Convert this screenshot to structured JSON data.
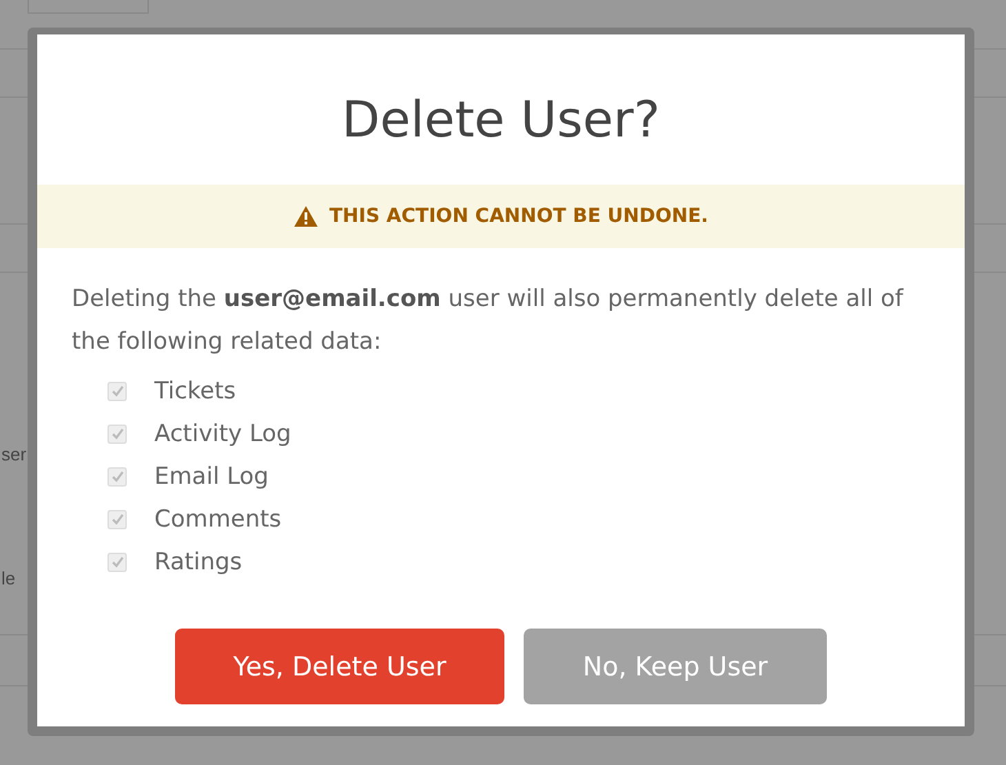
{
  "background": {
    "fragments": [
      "ser",
      "le"
    ]
  },
  "dialog": {
    "title": "Delete User?",
    "warning": "THIS ACTION CANNOT BE UNDONE.",
    "message": "Deleting the **user@email.com** user will also permanently delete all of the following related data:",
    "items": [
      {
        "label": "Tickets",
        "checked": true,
        "disabled": true
      },
      {
        "label": "Activity Log",
        "checked": true,
        "disabled": true
      },
      {
        "label": "Email Log",
        "checked": true,
        "disabled": true
      },
      {
        "label": "Comments",
        "checked": true,
        "disabled": true
      },
      {
        "label": "Ratings",
        "checked": true,
        "disabled": true
      }
    ],
    "buttons": [
      {
        "label": "Yes, Delete User",
        "kind": "danger"
      },
      {
        "label": "No, Keep User",
        "kind": "cancel"
      }
    ]
  }
}
